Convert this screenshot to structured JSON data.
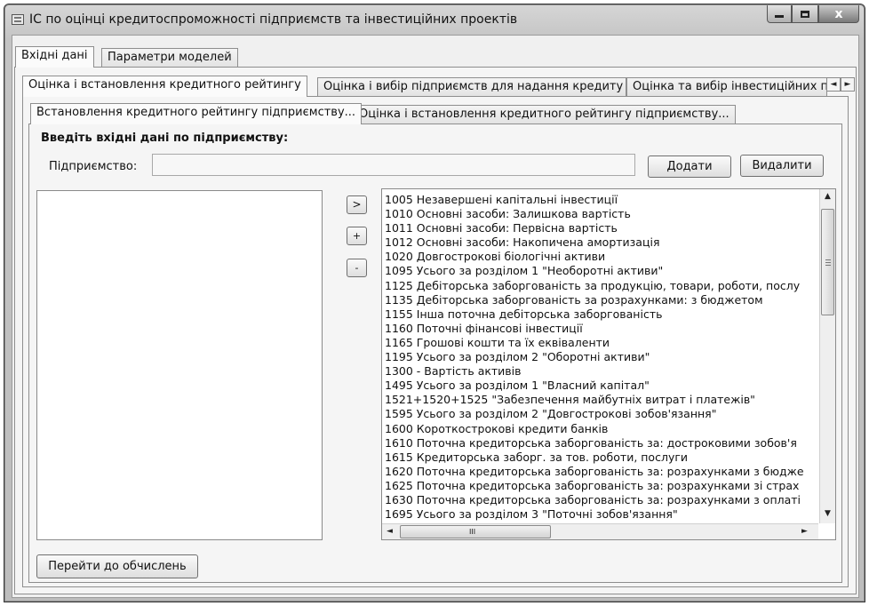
{
  "window": {
    "title": "ІС по оцінці кредитоспроможності підприємств та інвестиційних проектів",
    "minimize": "",
    "maximize": "",
    "close": "x"
  },
  "top_tabs": [
    "Вхідні дані",
    "Параметри моделей"
  ],
  "second_tabs": [
    "Оцінка і встановлення кредитного рейтингу",
    "Оцінка і вибір підприємств для надання кредиту",
    "Оцінка та вибір інвестиційних п"
  ],
  "third_tabs": [
    "Встановлення кредитного рейтингу підприємству...",
    "Оцінка і встановлення кредитного рейтингу підприємству..."
  ],
  "tab_scroll": {
    "left": "◄",
    "right": "►"
  },
  "form": {
    "heading": "Введіть вхідні дані по підприємству:",
    "enterprise_label": "Підприємство:",
    "enterprise_value": "",
    "add_button": "Додати",
    "delete_button": "Видалити"
  },
  "transfer_buttons": {
    "move": ">",
    "plus": "+",
    "minus": "-"
  },
  "indicators": [
    "1005 Незавершені капітальні інвестиції",
    "1010 Основні засоби: Залишкова вартість",
    "1011 Основні засоби: Первісна вартість",
    "1012 Основні засоби: Накопичена амортизація",
    "1020 Довгострокові біологічні активи",
    "1095 Усього за розділом 1 \"Необоротні активи\"",
    "1125 Дебіторська заборгованість за продукцію, товари, роботи, послу",
    "1135 Дебіторська заборгованість за розрахунками: з бюджетом",
    "1155 Інша поточна дебіторська заборгованість",
    "1160 Поточні фінансові інвестиції",
    "1165 Грошові кошти та їх еквіваленти",
    "1195 Усього за розділом 2 \"Оборотні активи\"",
    "1300 - Вартість активів",
    "1495 Усього за розділом 1 \"Власний капітал\"",
    "1521+1520+1525 \"Забезпечення майбутніх витрат і платежів\"",
    "1595 Усього за розділом 2 \"Довгострокові зобов'язання\"",
    "1600 Короткострокові кредити банків",
    "1610 Поточна кредиторська заборгованість за: достроковими зобов'я",
    "1615 Кредиторська заборг. за тов. роботи, послуги",
    "1620 Поточна кредиторська заборгованість за: розрахунками з бюдже",
    " 1625 Поточна кредиторська заборгованість за: розрахунками зі страх",
    "1630 Поточна кредиторська заборгованість за: розрахунками з оплаті",
    "1695 Усього за розділом 3 \"Поточні зобов'язання\""
  ],
  "scrollbar": {
    "up": "▲",
    "down": "▼",
    "left": "◄",
    "right": "►",
    "grip": "≡",
    "hgrip": "III"
  },
  "footer": {
    "compute_button": "Перейти до обчислень"
  },
  "colors": {
    "window_frame": "#c4c4c4",
    "panel": "#f5f5f5",
    "list_bg": "#ffffff"
  }
}
